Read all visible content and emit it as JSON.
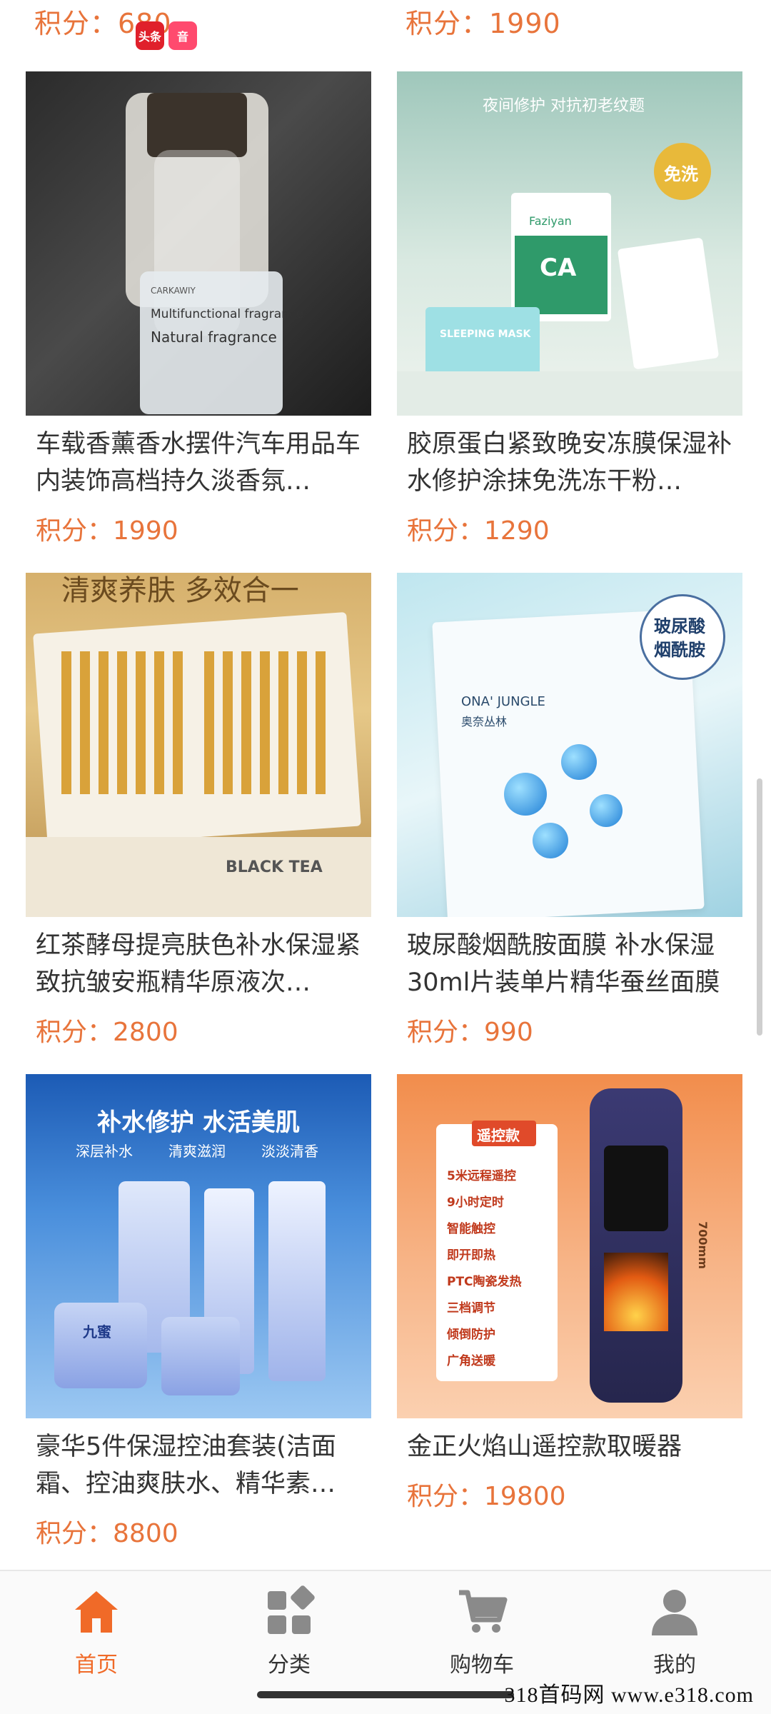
{
  "top_row": {
    "left_price": "积分：680",
    "right_price": "积分：1990",
    "float_icons": [
      {
        "name": "toutiao-icon",
        "label": "头条"
      },
      {
        "name": "douyin-icon",
        "label": "音"
      }
    ]
  },
  "products": [
    {
      "id": "car-fragrance",
      "title": "车载香薰香水摆件汽车用品车内装饰高档持久淡香氛…",
      "price_label": "积分：",
      "price_value": "1990",
      "image_text": [
        "Multifunctional fragrance",
        "Natural fragrance",
        "CARKAWIY"
      ]
    },
    {
      "id": "collagen-mask",
      "title": "胶原蛋白紧致晚安冻膜保湿补水修护涂抹免洗冻干粉…",
      "price_label": "积分：",
      "price_value": "1290",
      "image_text": [
        "夜间修护 对抗初老纹题",
        "免洗",
        "CA",
        "Faziyan",
        "SLEEPING MASK"
      ]
    },
    {
      "id": "black-tea-ampoule",
      "title": "红茶酵母提亮肤色补水保湿紧致抗皱安瓶精华原液次…",
      "price_label": "积分：",
      "price_value": "2800",
      "image_text": [
        "清爽养肤 多效合一",
        "BLACK TEA"
      ]
    },
    {
      "id": "hyaluronic-mask",
      "title": "玻尿酸烟酰胺面膜 补水保湿30ml片装单片精华蚕丝面膜",
      "price_label": "积分：",
      "price_value": "990",
      "image_text": [
        "玻尿酸",
        "烟酰胺",
        "ONA' JUNGLE",
        "奥奈丛林"
      ]
    },
    {
      "id": "skincare-set",
      "title": "豪华5件保湿控油套装(洁面霜、控油爽肤水、精华素…",
      "price_label": "积分：",
      "price_value": "8800",
      "image_text": [
        "补水修护 水活美肌",
        "深层补水",
        "清爽滋润",
        "淡淡清香",
        "九蜜"
      ]
    },
    {
      "id": "heater",
      "title": "金正火焰山遥控款取暖器",
      "price_label": "积分：",
      "price_value": "19800",
      "image_text": [
        "遥控款",
        "5米远程遥控",
        "9小时定时",
        "智能触控",
        "即开即热",
        "PTC陶瓷发热",
        "三档调节",
        "倾倒防护",
        "广角送暖",
        "700mm"
      ]
    }
  ],
  "bottom_nav": [
    {
      "label": "首页",
      "icon": "home-icon",
      "active": true
    },
    {
      "label": "分类",
      "icon": "category-icon",
      "active": false
    },
    {
      "label": "购物车",
      "icon": "cart-icon",
      "active": false
    },
    {
      "label": "我的",
      "icon": "profile-icon",
      "active": false
    }
  ],
  "watermark": "318首码网 www.e318.com",
  "colors": {
    "accent": "#f06a28",
    "price": "#e8743b"
  }
}
